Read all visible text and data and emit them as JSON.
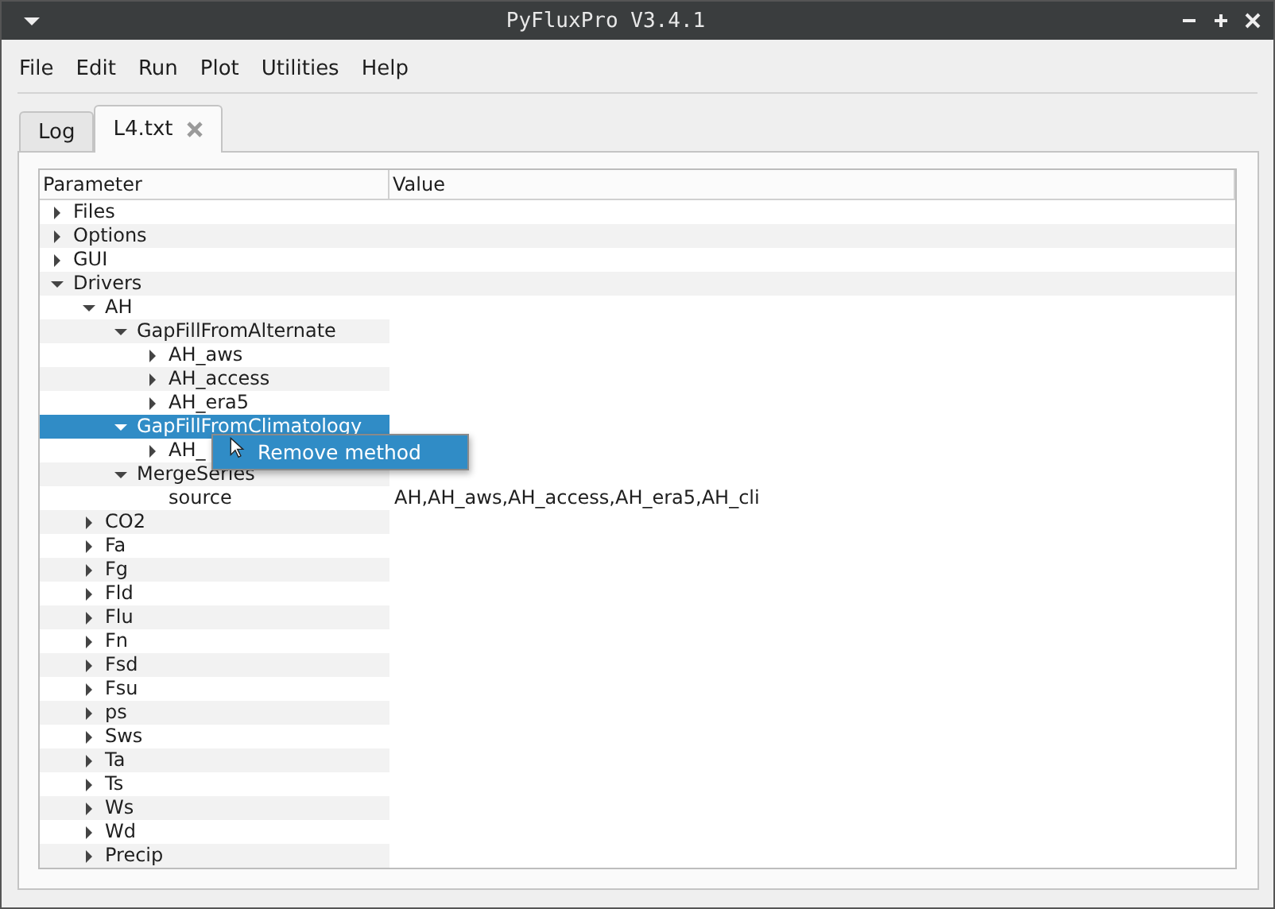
{
  "window": {
    "title": "PyFluxPro V3.4.1"
  },
  "menu": [
    "File",
    "Edit",
    "Run",
    "Plot",
    "Utilities",
    "Help"
  ],
  "tabs": [
    {
      "label": "Log",
      "selected": false,
      "closable": false
    },
    {
      "label": "L4.txt",
      "selected": true,
      "closable": true
    }
  ],
  "tree": {
    "columns": [
      "Parameter",
      "Value"
    ],
    "items": [
      {
        "label": "Files",
        "expanded": false,
        "selected": false
      },
      {
        "label": "Options",
        "expanded": false,
        "selected": false
      },
      {
        "label": "GUI",
        "expanded": false,
        "selected": false
      },
      {
        "label": "Drivers",
        "expanded": true,
        "selected": false,
        "children": [
          {
            "label": "AH",
            "expanded": true,
            "selected": false,
            "children": [
              {
                "label": "GapFillFromAlternate",
                "expanded": true,
                "selected": false,
                "children": [
                  {
                    "label": "AH_aws",
                    "expanded": false,
                    "selected": false
                  },
                  {
                    "label": "AH_access",
                    "expanded": false,
                    "selected": false
                  },
                  {
                    "label": "AH_era5",
                    "expanded": false,
                    "selected": false
                  }
                ]
              },
              {
                "label": "GapFillFromClimatology",
                "expanded": true,
                "selected": true,
                "children": [
                  {
                    "label": "AH_",
                    "expanded": false,
                    "selected": false
                  }
                ]
              },
              {
                "label": "MergeSeries",
                "expanded": true,
                "selected": false,
                "children": [
                  {
                    "label": "source",
                    "value": "AH,AH_aws,AH_access,AH_era5,AH_cli",
                    "selected": false
                  }
                ]
              }
            ]
          },
          {
            "label": "CO2",
            "expanded": false,
            "selected": false
          },
          {
            "label": "Fa",
            "expanded": false,
            "selected": false
          },
          {
            "label": "Fg",
            "expanded": false,
            "selected": false
          },
          {
            "label": "Fld",
            "expanded": false,
            "selected": false
          },
          {
            "label": "Flu",
            "expanded": false,
            "selected": false
          },
          {
            "label": "Fn",
            "expanded": false,
            "selected": false
          },
          {
            "label": "Fsd",
            "expanded": false,
            "selected": false
          },
          {
            "label": "Fsu",
            "expanded": false,
            "selected": false
          },
          {
            "label": "ps",
            "expanded": false,
            "selected": false
          },
          {
            "label": "Sws",
            "expanded": false,
            "selected": false
          },
          {
            "label": "Ta",
            "expanded": false,
            "selected": false
          },
          {
            "label": "Ts",
            "expanded": false,
            "selected": false
          },
          {
            "label": "Ws",
            "expanded": false,
            "selected": false
          },
          {
            "label": "Wd",
            "expanded": false,
            "selected": false
          },
          {
            "label": "Precip",
            "expanded": false,
            "selected": false
          }
        ]
      }
    ]
  },
  "context_menu": {
    "items": [
      {
        "label": "Remove method",
        "selected": true
      }
    ]
  }
}
